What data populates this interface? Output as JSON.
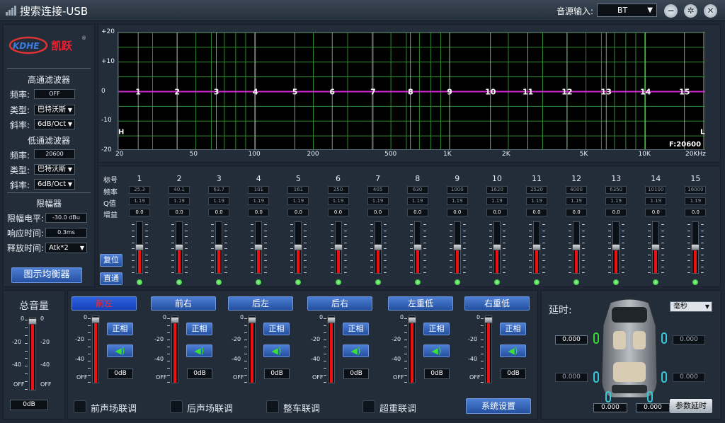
{
  "window": {
    "title": "搜索连接-USB",
    "source_label": "音源输入:",
    "source_value": "BT",
    "min": "−",
    "restore": "✕",
    "close": "✕"
  },
  "hpf": {
    "title": "高通滤波器",
    "freq_label": "频率:",
    "freq": "OFF",
    "type_label": "类型:",
    "type": "巴特沃斯",
    "slope_label": "斜率:",
    "slope": "6dB/Oct"
  },
  "lpf": {
    "title": "低通滤波器",
    "freq_label": "频率:",
    "freq": "20600",
    "type_label": "类型:",
    "type": "巴特沃斯",
    "slope_label": "斜率:",
    "slope": "6dB/Oct"
  },
  "limiter": {
    "title": "限幅器",
    "level_label": "限幅电平:",
    "level": "-30.0 dBu",
    "attack_label": "响应时间:",
    "attack": "0.3ms",
    "release_label": "释放时间:",
    "release": "Atk*2"
  },
  "graphic_eq_button": "图示均衡器",
  "graph": {
    "y_ticks": [
      "+20",
      "+10",
      "0",
      "-10",
      "-20"
    ],
    "x_ticks": [
      "20",
      "50",
      "100",
      "200",
      "500",
      "1K",
      "2K",
      "5K",
      "10K",
      "20KHz"
    ],
    "h_marker": "H",
    "l_marker": "L",
    "freq_readout": "F:20600"
  },
  "eq": {
    "row_labels": {
      "num": "标号",
      "freq": "频率",
      "q": "Q值",
      "gain": "增益"
    },
    "reset": "复位",
    "pass": "直通",
    "bands": [
      {
        "n": "1",
        "f": "25.3",
        "q": "1.19",
        "g": "0.0"
      },
      {
        "n": "2",
        "f": "40.1",
        "q": "1.19",
        "g": "0.0"
      },
      {
        "n": "3",
        "f": "63.7",
        "q": "1.19",
        "g": "0.0"
      },
      {
        "n": "4",
        "f": "101",
        "q": "1.19",
        "g": "0.0"
      },
      {
        "n": "5",
        "f": "161",
        "q": "1.19",
        "g": "0.0"
      },
      {
        "n": "6",
        "f": "250",
        "q": "1.19",
        "g": "0.0"
      },
      {
        "n": "7",
        "f": "405",
        "q": "1.19",
        "g": "0.0"
      },
      {
        "n": "8",
        "f": "630",
        "q": "1.19",
        "g": "0.0"
      },
      {
        "n": "9",
        "f": "1000",
        "q": "1.19",
        "g": "0.0"
      },
      {
        "n": "10",
        "f": "1620",
        "q": "1.19",
        "g": "0.0"
      },
      {
        "n": "11",
        "f": "2520",
        "q": "1.19",
        "g": "0.0"
      },
      {
        "n": "12",
        "f": "4000",
        "q": "1.19",
        "g": "0.0"
      },
      {
        "n": "13",
        "f": "6350",
        "q": "1.19",
        "g": "0.0"
      },
      {
        "n": "14",
        "f": "10100",
        "q": "1.19",
        "g": "0.0"
      },
      {
        "n": "15",
        "f": "16000",
        "q": "1.19",
        "g": "0.0"
      }
    ]
  },
  "master": {
    "title": "总音量",
    "value": "0dB",
    "ticks": [
      "0",
      "-20",
      "-40",
      "OFF"
    ]
  },
  "channels": [
    {
      "name": "前左",
      "phase": "正相",
      "db": "0dB",
      "active": true
    },
    {
      "name": "前右",
      "phase": "正相",
      "db": "0dB",
      "active": false
    },
    {
      "name": "后左",
      "phase": "正相",
      "db": "0dB",
      "active": false
    },
    {
      "name": "后右",
      "phase": "正相",
      "db": "0dB",
      "active": false
    },
    {
      "name": "左重低",
      "phase": "正相",
      "db": "0dB",
      "active": false
    },
    {
      "name": "右重低",
      "phase": "正相",
      "db": "0dB",
      "active": false
    }
  ],
  "channel_ticks": [
    "0",
    "-20",
    "-40",
    "OFF"
  ],
  "links": [
    "前声场联调",
    "后声场联调",
    "整车联调",
    "超重联调"
  ],
  "system_settings": "系统设置",
  "delay": {
    "title": "延时:",
    "unit": "毫秒",
    "values": [
      "0.000",
      "0.000",
      "0.000",
      "0.000",
      "0.000",
      "0.000"
    ],
    "param_button": "参数延时"
  },
  "colors": {
    "accent": "#2f66c8",
    "curve": "#d02ad0",
    "grid": "#2f8a2f",
    "fader": "#e11111"
  }
}
